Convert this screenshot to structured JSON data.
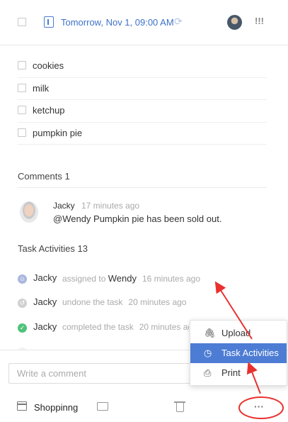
{
  "header": {
    "due_date": "Tomorrow,  Nov 1, 09:00 AM",
    "priority": "!!!",
    "icons": [
      "checkbox",
      "calendar-icon",
      "repeat-icon",
      "avatar",
      "priority-icon"
    ]
  },
  "checklist": {
    "items": [
      {
        "label": "cookies",
        "checked": false
      },
      {
        "label": "milk",
        "checked": false
      },
      {
        "label": "ketchup",
        "checked": false
      },
      {
        "label": "pumpkin pie",
        "checked": false
      }
    ]
  },
  "comments": {
    "title": "Comments  1",
    "items": [
      {
        "author": "Jacky",
        "time": "17 minutes ago",
        "body": "@Wendy Pumpkin pie has been sold out."
      }
    ]
  },
  "activities": {
    "title": "Task Activities  13",
    "items": [
      {
        "who": "Jacky",
        "action": "assigned to",
        "assignee": "Wendy",
        "time": "16 minutes ago",
        "icon": "assign-icon",
        "color": "#a9b7de"
      },
      {
        "who": "Jacky",
        "action": "undone the task",
        "assignee": "",
        "time": "20 minutes ago",
        "icon": "undo-icon",
        "color": "#d0d0d0"
      },
      {
        "who": "Jacky",
        "action": "completed the task",
        "assignee": "",
        "time": "20 minutes ago",
        "icon": "check-icon",
        "color": "#50c27a"
      }
    ]
  },
  "footer": {
    "comment_placeholder": "Write a comment",
    "list_name": "Shoppinng",
    "more": "···"
  },
  "menu": {
    "items": [
      {
        "label": "Upload",
        "icon": "paperclip-icon",
        "active": false
      },
      {
        "label": "Task Activities",
        "icon": "history-icon",
        "active": true
      },
      {
        "label": "Print",
        "icon": "printer-icon",
        "active": false
      }
    ]
  },
  "colors": {
    "accent": "#4d7cd4",
    "date_blue": "#3d72c9",
    "annotation_red": "#e8312f",
    "completed_green": "#50c27a"
  }
}
